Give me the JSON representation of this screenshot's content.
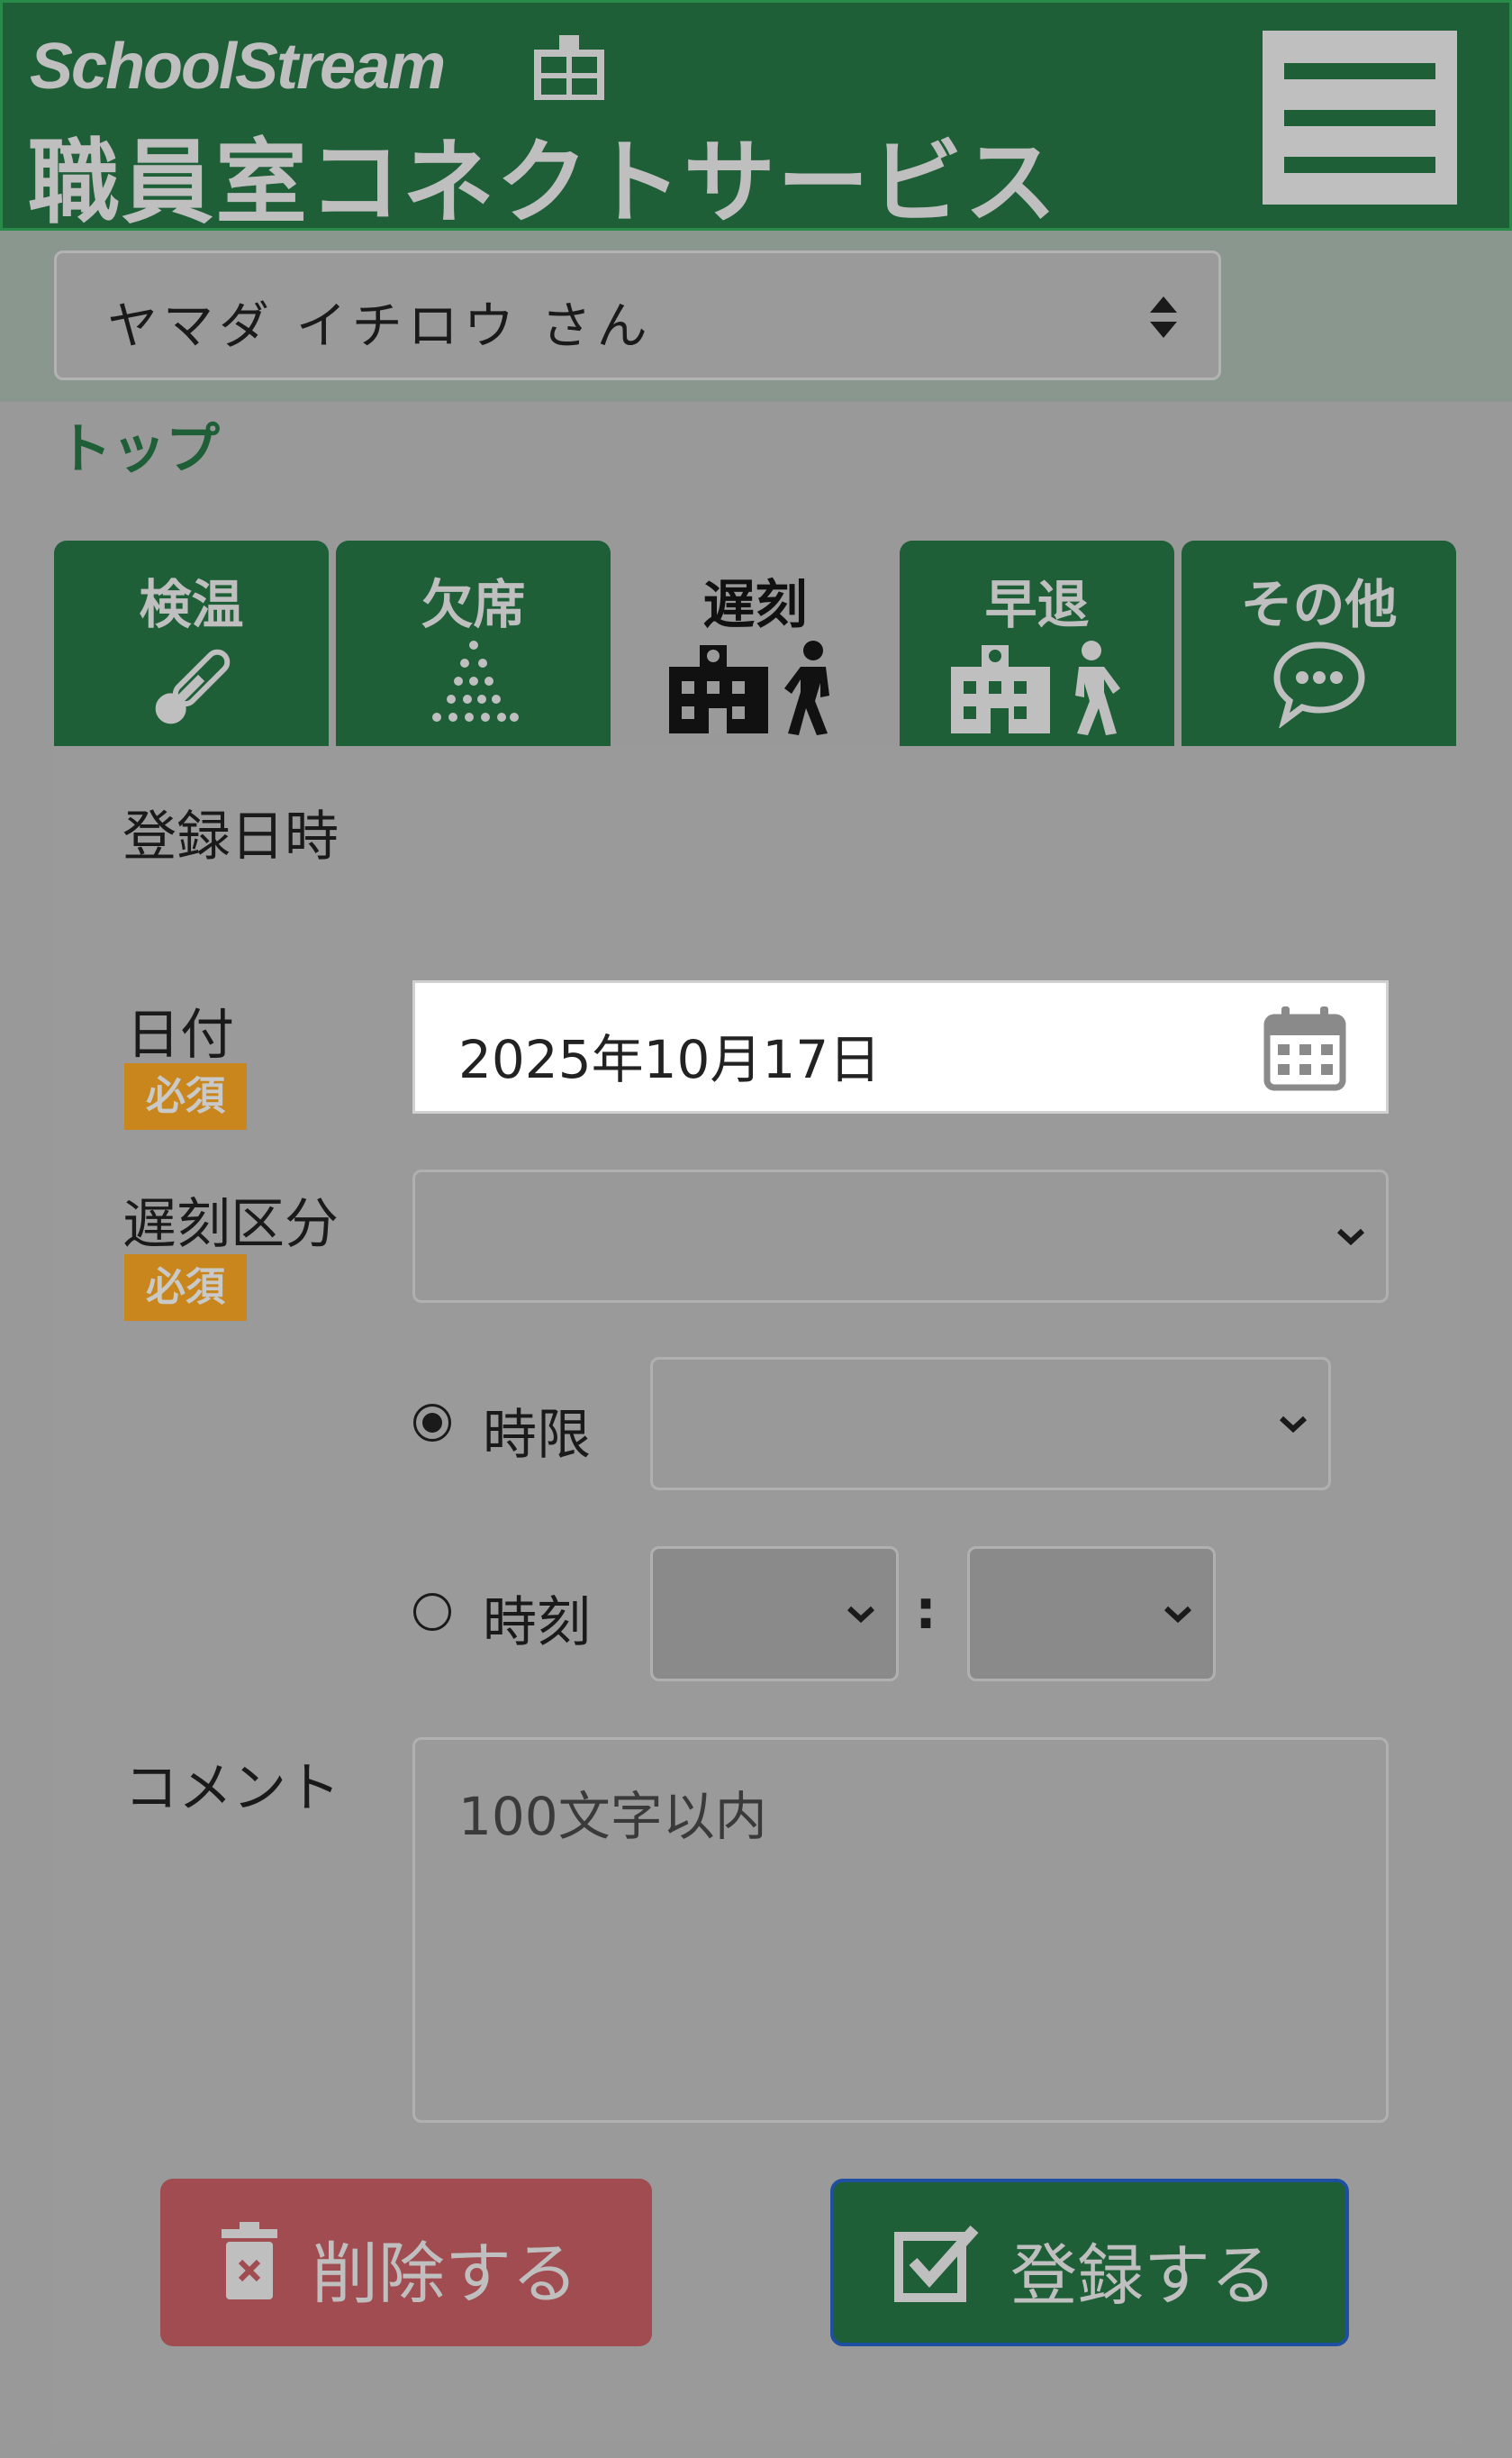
{
  "header": {
    "brand": "SchoolStream",
    "title": "職員室コネクトサービス",
    "menu_icon": "hamburger-icon"
  },
  "user": {
    "selected": "ヤマダ イチロウ さん"
  },
  "breadcrumb": {
    "label": "トップ"
  },
  "tabs": [
    {
      "label": "検温",
      "icon": "thermometer-icon"
    },
    {
      "label": "欠席",
      "icon": "dotted-triangle-icon"
    },
    {
      "label": "遅刻",
      "icon": "school-walk-in-icon",
      "active": true
    },
    {
      "label": "早退",
      "icon": "school-walk-out-icon"
    },
    {
      "label": "その他",
      "icon": "speech-bubble-icon"
    }
  ],
  "form": {
    "section_title": "登録日時",
    "date_label": "日付",
    "required_badge": "必須",
    "date_value": "2025年10月17日",
    "category_label": "遅刻区分",
    "category_value": "",
    "period_radio_label": "時限",
    "time_radio_label": "時刻",
    "time_separator": ":",
    "comment_label": "コメント",
    "comment_placeholder": "100文字以内",
    "delete_button": "削除する",
    "register_button": "登録する"
  },
  "colors": {
    "header_green": "#1e5f38",
    "required_orange": "#c8861c",
    "delete_red": "#a14c50",
    "overlay_gray": "#999999"
  }
}
